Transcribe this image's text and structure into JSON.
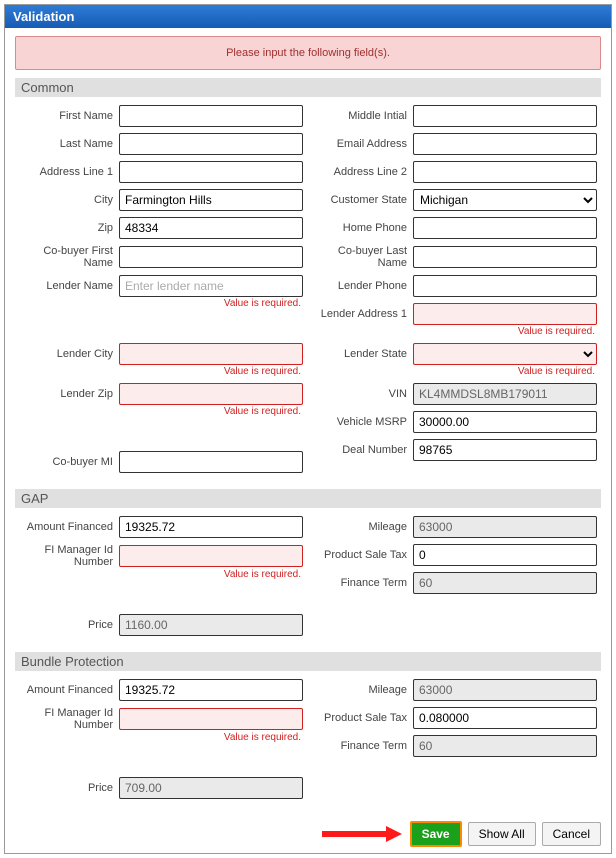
{
  "dialog": {
    "title": "Validation"
  },
  "alert": {
    "message": "Please input the following field(s)."
  },
  "errors": {
    "required": "Value is required."
  },
  "sections": {
    "common": {
      "title": "Common"
    },
    "gap": {
      "title": "GAP"
    },
    "bundle": {
      "title": "Bundle Protection"
    }
  },
  "labels": {
    "first_name": "First Name",
    "last_name": "Last Name",
    "address1": "Address Line 1",
    "city": "City",
    "zip": "Zip",
    "cobuyer_first": "Co-buyer First Name",
    "lender_name": "Lender Name",
    "lender_city": "Lender City",
    "lender_zip": "Lender Zip",
    "cobuyer_mi": "Co-buyer MI",
    "middle_initial": "Middle Intial",
    "email": "Email Address",
    "address2": "Address Line 2",
    "customer_state": "Customer State",
    "home_phone": "Home Phone",
    "cobuyer_last": "Co-buyer Last Name",
    "lender_phone": "Lender Phone",
    "lender_address1": "Lender Address 1",
    "lender_state": "Lender State",
    "vin": "VIN",
    "vehicle_msrp": "Vehicle MSRP",
    "deal_number": "Deal Number",
    "amount_financed": "Amount Financed",
    "fi_manager": "FI Manager Id Number",
    "price": "Price",
    "mileage": "Mileage",
    "product_sale_tax": "Product Sale Tax",
    "finance_term": "Finance Term"
  },
  "values": {
    "city": "Farmington Hills",
    "zip": "48334",
    "lender_name_placeholder": "Enter lender name",
    "customer_state": "Michigan",
    "vin": "KL4MMDSL8MB179011",
    "vehicle_msrp": "30000.00",
    "deal_number": "98765",
    "gap_amount_financed": "19325.72",
    "gap_mileage": "63000",
    "gap_product_sale_tax": "0",
    "gap_finance_term": "60",
    "gap_price": "1160.00",
    "bundle_amount_financed": "19325.72",
    "bundle_mileage": "63000",
    "bundle_product_sale_tax": "0.080000",
    "bundle_finance_term": "60",
    "bundle_price": "709.00"
  },
  "buttons": {
    "save": "Save",
    "show_all": "Show All",
    "cancel": "Cancel"
  }
}
